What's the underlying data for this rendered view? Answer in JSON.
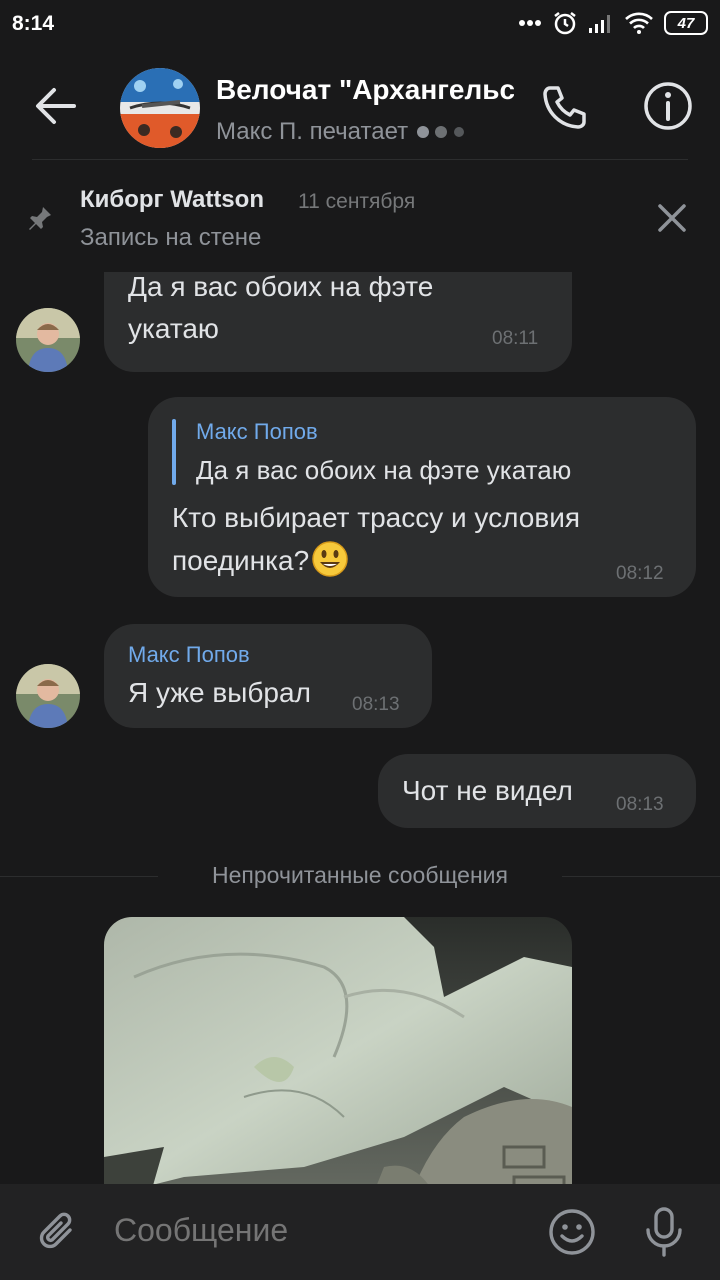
{
  "status": {
    "time": "8:14",
    "battery": "47",
    "icons": [
      "more-dots-icon",
      "alarm-icon",
      "signal-icon",
      "wifi-icon",
      "battery-icon"
    ]
  },
  "header": {
    "title": "Велочат \"Архангельск\"",
    "subtitle": "Макс П. печатает",
    "typing_indicator": "●●●"
  },
  "pinned": {
    "author": "Киборг Wattson",
    "date": "11 сентября",
    "text": "Запись на стене"
  },
  "messages": [
    {
      "from": "incoming",
      "text": "Да я вас обоих на фэте укатаю",
      "text_line1": "Да я вас обоих на фэте",
      "text_line2": "укатаю",
      "time": "08:11"
    },
    {
      "from": "outgoing",
      "reply_author": "Макс Попов",
      "reply_text": "Да я вас обоих на фэте укатаю",
      "text_line1": "Кто выбирает трассу и условия",
      "text_line2": "поединка?",
      "time": "08:12"
    },
    {
      "from": "incoming",
      "sender": "Макс Попов",
      "text": "Я уже выбрал",
      "time": "08:13"
    },
    {
      "from": "outgoing",
      "text": "Чот не видел",
      "time": "08:13"
    }
  ],
  "unread_label": "Непрочитанные сообщения",
  "composer": {
    "placeholder": "Сообщение"
  },
  "colors": {
    "background": "#19191a",
    "bubble": "#2c2d2e",
    "accent": "#71aaeb",
    "secondary_text": "#8f9399"
  }
}
